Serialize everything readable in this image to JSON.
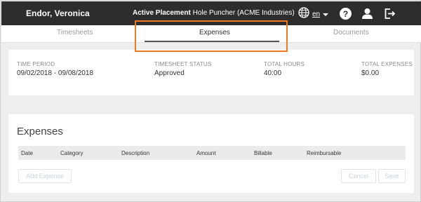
{
  "header": {
    "user_name": "Endor, Veronica",
    "placement_label": "Active Placement",
    "placement_value": "Hole Puncher (ACME Industries)",
    "language": "en",
    "icons": [
      "globe-icon",
      "help-icon",
      "person-icon",
      "logout-icon"
    ],
    "help_glyph": "?"
  },
  "tabs": [
    {
      "label": "Timesheets",
      "active": false
    },
    {
      "label": "Expenses",
      "active": true
    },
    {
      "label": "Documents",
      "active": false
    }
  ],
  "highlight_color": "#f07a22",
  "summary": {
    "time_period": {
      "label": "TIME PERIOD",
      "value": "09/02/2018 - 09/08/2018"
    },
    "status": {
      "label": "TIMESHEET STATUS",
      "value": "Approved"
    },
    "hours": {
      "label": "TOTAL HOURS",
      "value": "40:00"
    },
    "expenses": {
      "label": "TOTAL EXPENSES",
      "value": "$0.00"
    }
  },
  "expenses": {
    "title": "Expenses",
    "columns": [
      "Date",
      "Category",
      "Description",
      "Amount",
      "Billable",
      "Reimbursable"
    ],
    "rows": [],
    "add_button": "Add Expense",
    "cancel_button": "Cancel",
    "save_button": "Save"
  }
}
